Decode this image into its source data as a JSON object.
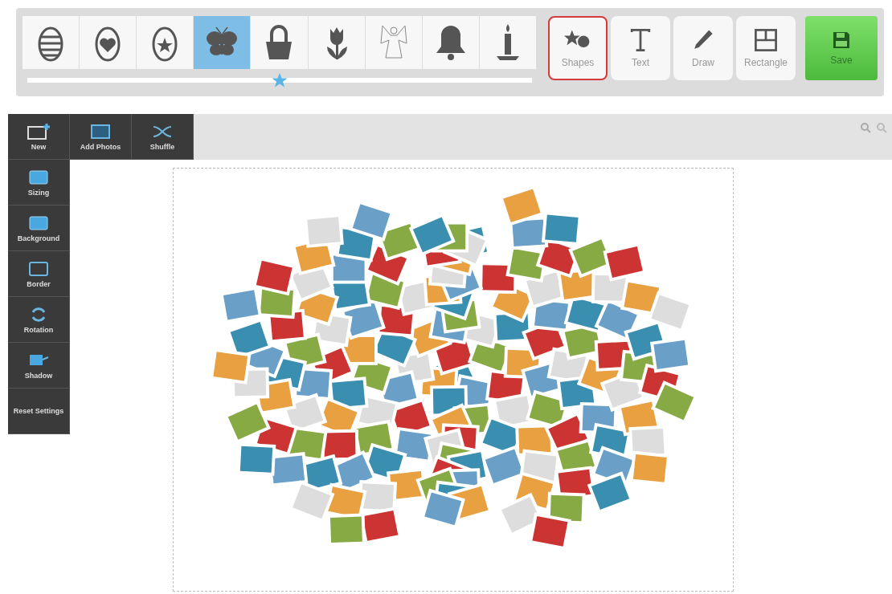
{
  "shape_palette": {
    "shapes": [
      {
        "kind": "striped-egg",
        "selected": false
      },
      {
        "kind": "heart-egg",
        "selected": false
      },
      {
        "kind": "star-egg",
        "selected": false
      },
      {
        "kind": "butterfly",
        "selected": true
      },
      {
        "kind": "basket",
        "selected": false
      },
      {
        "kind": "tulip",
        "selected": false
      },
      {
        "kind": "angel",
        "selected": false
      },
      {
        "kind": "bell",
        "selected": false
      },
      {
        "kind": "candle",
        "selected": false
      }
    ],
    "slider": {
      "level": 0.5
    }
  },
  "tools": [
    {
      "kind": "shapes",
      "label": "Shapes",
      "selected": true
    },
    {
      "kind": "text",
      "label": "Text",
      "selected": false
    },
    {
      "kind": "draw",
      "label": "Draw",
      "selected": false
    },
    {
      "kind": "rectangle",
      "label": "Rectangle",
      "selected": false
    }
  ],
  "save_button": {
    "label": "Save"
  },
  "top_menu": [
    {
      "kind": "new",
      "label": "New"
    },
    {
      "kind": "add-photos",
      "label": "Add Photos"
    },
    {
      "kind": "shuffle",
      "label": "Shuffle"
    }
  ],
  "side_menu": [
    {
      "kind": "sizing",
      "label": "Sizing"
    },
    {
      "kind": "background",
      "label": "Background"
    },
    {
      "kind": "border",
      "label": "Border"
    },
    {
      "kind": "rotation",
      "label": "Rotation"
    },
    {
      "kind": "shadow",
      "label": "Shadow"
    },
    {
      "kind": "reset",
      "label": "Reset Settings"
    }
  ]
}
